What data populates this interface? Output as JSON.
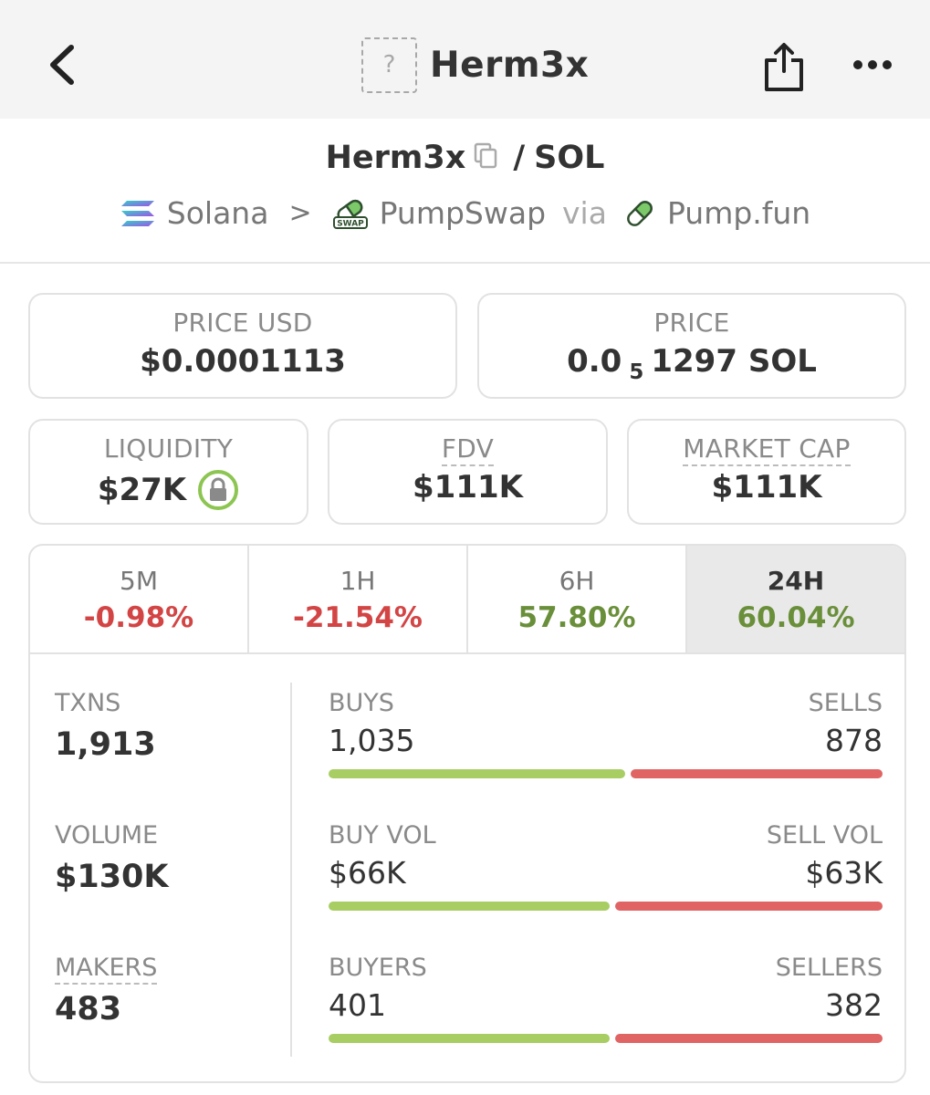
{
  "nav": {
    "title": "Herm3x",
    "placeholder_glyph": "?",
    "icons": {
      "back": "chevron-left-icon",
      "share": "share-icon",
      "more": "more-horizontal-icon"
    }
  },
  "pair": {
    "base": "Herm3x",
    "slash": "/",
    "quote": "SOL"
  },
  "breadcrumb": {
    "chain": "Solana",
    "separator": ">",
    "dex": "PumpSwap",
    "via": "via",
    "launchpad": "Pump.fun"
  },
  "stats": {
    "price_usd": {
      "label": "PRICE USD",
      "value": "$0.0001113"
    },
    "price": {
      "label": "PRICE",
      "prefix": "0.0",
      "zeros": "5",
      "suffix": "1297 SOL"
    },
    "liquidity": {
      "label": "LIQUIDITY",
      "value": "$27K",
      "locked": true
    },
    "fdv": {
      "label": "FDV",
      "value": "$111K"
    },
    "market_cap": {
      "label": "MARKET CAP",
      "value": "$111K"
    }
  },
  "timeframes": [
    {
      "label": "5M",
      "change": "-0.98%",
      "direction": "down"
    },
    {
      "label": "1H",
      "change": "-21.54%",
      "direction": "down"
    },
    {
      "label": "6H",
      "change": "57.80%",
      "direction": "up"
    },
    {
      "label": "24H",
      "change": "60.04%",
      "direction": "up",
      "active": true
    }
  ],
  "activity": {
    "txns": {
      "label": "TXNS",
      "value": "1,913"
    },
    "volume": {
      "label": "VOLUME",
      "value": "$130K"
    },
    "makers": {
      "label": "MAKERS",
      "value": "483"
    },
    "buys": {
      "label": "BUYS",
      "value": "1,035",
      "count": 1035
    },
    "sells": {
      "label": "SELLS",
      "value": "878",
      "count": 878
    },
    "buy_vol": {
      "label": "BUY VOL",
      "value": "$66K",
      "amount": 66
    },
    "sell_vol": {
      "label": "SELL VOL",
      "value": "$63K",
      "amount": 63
    },
    "buyers": {
      "label": "BUYERS",
      "value": "401",
      "count": 401
    },
    "sellers": {
      "label": "SELLERS",
      "value": "382",
      "count": 382
    }
  },
  "colors": {
    "buy": "#a8cd62",
    "sell": "#e06464",
    "positive": "#6a8f3a",
    "negative": "#d34545",
    "lock_ring": "#8dc552"
  }
}
